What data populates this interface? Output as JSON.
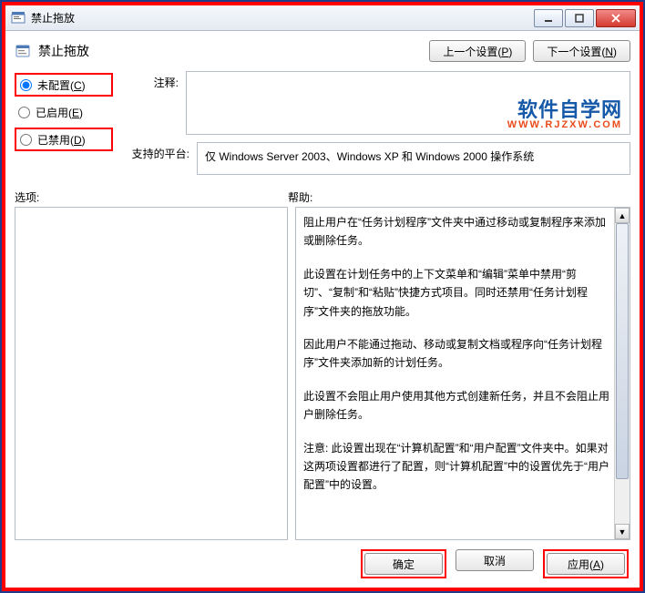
{
  "window": {
    "title": "禁止拖放"
  },
  "header": {
    "title": "禁止拖放",
    "prev": "上一个设置(P)",
    "next": "下一个设置(N)"
  },
  "radios": {
    "not_configured": "未配置(C)",
    "enabled": "已启用(E)",
    "disabled": "已禁用(D)"
  },
  "labels": {
    "comment": "注释:",
    "platforms": "支持的平台:",
    "options": "选项:",
    "help": "帮助:"
  },
  "platforms_text": "仅 Windows Server 2003、Windows XP 和 Windows 2000 操作系统",
  "help_paragraphs": [
    "阻止用户在“任务计划程序”文件夹中通过移动或复制程序来添加或删除任务。",
    "此设置在计划任务中的上下文菜单和“编辑”菜单中禁用“剪切”、“复制”和“粘贴”快捷方式项目。同时还禁用“任务计划程序”文件夹的拖放功能。",
    "因此用户不能通过拖动、移动或复制文档或程序向“任务计划程序”文件夹添加新的计划任务。",
    "此设置不会阻止用户使用其他方式创建新任务，并且不会阻止用户删除任务。",
    "注意: 此设置出现在“计算机配置”和“用户配置”文件夹中。如果对这两项设置都进行了配置，则“计算机配置”中的设置优先于“用户配置”中的设置。"
  ],
  "footer": {
    "ok": "确定",
    "cancel": "取消",
    "apply": "应用(A)"
  },
  "watermark": {
    "line1": "软件自学网",
    "line2": "WWW.RJZXW.COM"
  }
}
